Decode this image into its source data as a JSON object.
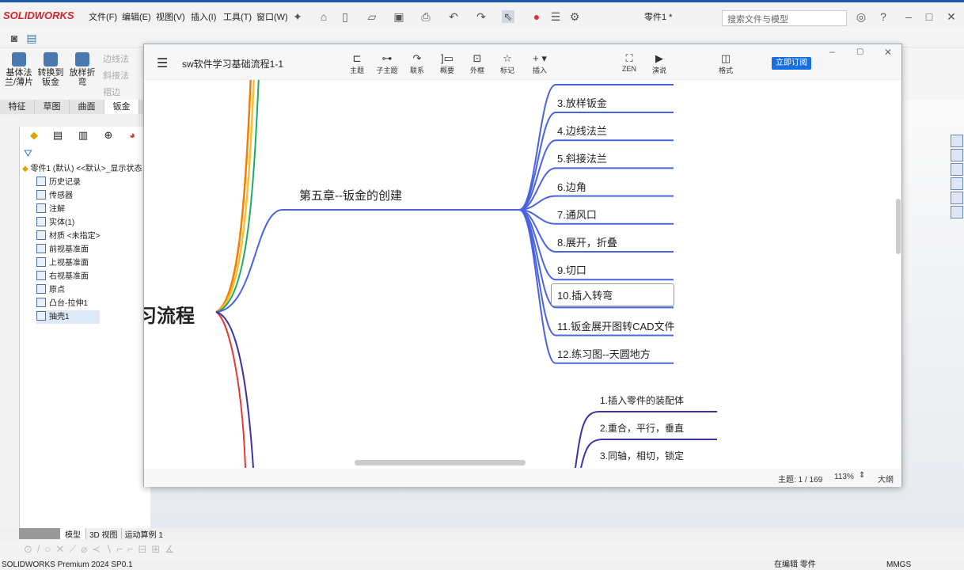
{
  "app": {
    "brand": "SOLIDWORKS",
    "doc_title": "零件1 *",
    "search_placeholder": "搜索文件与模型",
    "menus": [
      "文件(F)",
      "编辑(E)",
      "视图(V)",
      "插入(I)",
      "工具(T)",
      "窗口(W)"
    ]
  },
  "command_manager": {
    "buttons": [
      "基体法兰/薄片",
      "转换到钣金",
      "放样折弯"
    ],
    "disabled": [
      "边线法",
      "斜接法",
      "褶边"
    ],
    "tabs": [
      "特征",
      "草图",
      "曲面",
      "钣金"
    ]
  },
  "feature_tree": {
    "root": "零件1 (默认) <<默认>_显示状态",
    "items": [
      "历史记录",
      "传感器",
      "注解",
      "实体(1)",
      "材质 <未指定>",
      "前视基准面",
      "上视基准面",
      "右视基准面",
      "原点",
      "凸台-拉伸1",
      "抽壳1"
    ]
  },
  "mindmap": {
    "title": "sw软件学习基础流程1-1",
    "tools": [
      {
        "icon": "⊏",
        "label": "主题"
      },
      {
        "icon": "⊶",
        "label": "子主题"
      },
      {
        "icon": "↷",
        "label": "联系"
      },
      {
        "icon": "]▭",
        "label": "概要"
      },
      {
        "icon": "⊡",
        "label": "外框"
      },
      {
        "icon": "☆",
        "label": "标记"
      },
      {
        "icon": "+ ▾",
        "label": "插入"
      }
    ],
    "right_tools": [
      {
        "icon": "⛶",
        "label": "ZEN"
      },
      {
        "icon": "▶",
        "label": "演说"
      },
      {
        "icon": "◫",
        "label": "格式"
      }
    ],
    "subscribe": "立即订阅",
    "root_label": "习流程",
    "chapter": "第五章--钣金的创建",
    "chapter_items": [
      "3.放样钣金",
      "4.边线法兰",
      "5.斜接法兰",
      "6.边角",
      "7.通风口",
      "8.展开，折叠",
      "9.切口",
      "10.插入转弯",
      "11.钣金展开图转CAD文件",
      "12.练习图--天圆地方"
    ],
    "next_items": [
      "1.插入零件的装配体",
      "2.重合，平行，垂直",
      "3.同轴，相切，锁定"
    ],
    "footer": {
      "topic": "主题: 1 / 169",
      "zoom": "113%",
      "outline": "大纲"
    },
    "colors": {
      "blue": "#4a63e0",
      "navy": "#3b35a8",
      "red": "#e53935",
      "orange": "#f57c00",
      "yellow": "#fbc02d",
      "green": "#1faa6b"
    }
  },
  "bottom_tabs": [
    "模型",
    "3D 视图",
    "运动算例 1"
  ],
  "status": {
    "left": "SOLIDWORKS Premium 2024 SP0.1",
    "mid": "在编辑 零件",
    "units": "MMGS"
  }
}
